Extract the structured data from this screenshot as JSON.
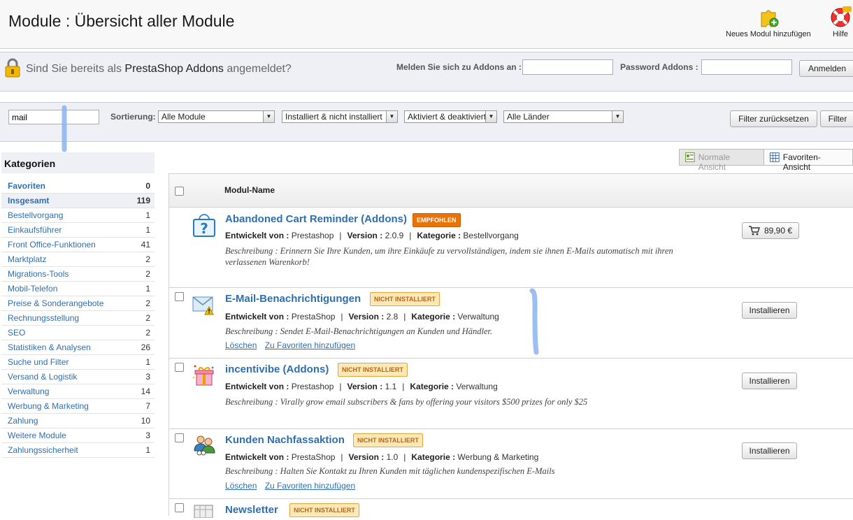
{
  "header": {
    "title": "Module : Übersicht aller Module",
    "add_module_label": "Neues Modul hinzufügen",
    "help_label": "Hilfe"
  },
  "addons": {
    "question_prefix": "Sind Sie bereits als",
    "question_brand": "PrestaShop Addons",
    "question_suffix": "angemeldet?",
    "login_label": "Melden Sie sich zu Addons an :",
    "password_label": "Password Addons :",
    "login_value": "",
    "password_value": "",
    "login_button": "Anmelden"
  },
  "filters": {
    "search_value": "mail",
    "sort_label": "Sortierung:",
    "select_modules": "Alle Module",
    "select_installed": "Installiert & nicht installiert",
    "select_active": "Aktiviert & deaktiviert",
    "select_country": "Alle Länder",
    "reset_button": "Filter zurücksetzen",
    "filter_button": "Filter"
  },
  "sidebar": {
    "title": "Kategorien",
    "items": [
      {
        "label": "Favoriten",
        "count": "0"
      },
      {
        "label": "Insgesamt",
        "count": "119"
      },
      {
        "label": "Bestellvorgang",
        "count": "1"
      },
      {
        "label": "Einkaufsführer",
        "count": "1"
      },
      {
        "label": "Front Office-Funktionen",
        "count": "41"
      },
      {
        "label": "Marktplatz",
        "count": "2"
      },
      {
        "label": "Migrations-Tools",
        "count": "2"
      },
      {
        "label": "Mobil-Telefon",
        "count": "1"
      },
      {
        "label": "Preise & Sonderangebote",
        "count": "2"
      },
      {
        "label": "Rechnungsstellung",
        "count": "2"
      },
      {
        "label": "SEO",
        "count": "2"
      },
      {
        "label": "Statistiken & Analysen",
        "count": "26"
      },
      {
        "label": "Suche und Filter",
        "count": "1"
      },
      {
        "label": "Versand & Logistik",
        "count": "3"
      },
      {
        "label": "Verwaltung",
        "count": "14"
      },
      {
        "label": "Werbung & Marketing",
        "count": "7"
      },
      {
        "label": "Zahlung",
        "count": "10"
      },
      {
        "label": "Weitere Module",
        "count": "3"
      },
      {
        "label": "Zahlungssicherheit",
        "count": "1"
      }
    ]
  },
  "view": {
    "normal_label": "Normale Ansicht",
    "favorites_label": "Favoriten-Ansicht"
  },
  "table": {
    "column_header": "Modul-Name",
    "labels": {
      "developer": "Entwickelt von :",
      "version": "Version :",
      "category": "Kategorie :",
      "separator": "|"
    },
    "modules": [
      {
        "name": "Abandoned Cart Reminder (Addons)",
        "badge": "EMPFOHLEN",
        "developer": "Prestashop",
        "version": "2.0.9",
        "category": "Bestellvorgang",
        "description": "Beschreibung : Erinnern Sie Ihre Kunden, um ihre Einkäufe zu vervollständigen, indem sie ihnen E-Mails automatisch mit ihren verlassenen Warenkorb!",
        "action": "89,90 €"
      },
      {
        "name": "E-Mail-Benachrichtigungen",
        "badge": "NICHT INSTALLIERT",
        "developer": "PrestaShop",
        "version": "2.8",
        "category": "Verwaltung",
        "description": "Beschreibung : Sendet E-Mail-Benachrichtigungen an Kunden und Händler.",
        "link_delete": "Löschen",
        "link_fav": "Zu Favoriten hinzufügen",
        "action": "Installieren"
      },
      {
        "name": "incentivibe (Addons)",
        "badge": "NICHT INSTALLIERT",
        "developer": "Prestashop",
        "version": "1.1",
        "category": "Verwaltung",
        "description": "Beschreibung : Virally grow email subscribers & fans by offering your visitors $500 prizes for only $25",
        "action": "Installieren"
      },
      {
        "name": "Kunden Nachfassaktion",
        "badge": "NICHT INSTALLIERT",
        "developer": "PrestaShop",
        "version": "1.0",
        "category": "Werbung & Marketing",
        "description": "Beschreibung : Halten Sie Kontakt zu Ihren Kunden mit täglichen kundenspezifischen E-Mails",
        "link_delete": "Löschen",
        "link_fav": "Zu Favoriten hinzufügen",
        "action": "Installieren"
      },
      {
        "name": "Newsletter",
        "badge": "NICHT INSTALLIERT"
      }
    ]
  },
  "colors": {
    "link": "#2e6fb0",
    "recommended_badge": "#e8730a",
    "not_installed_badge": "#fce9b6",
    "bar_background": "#eef0f5"
  }
}
